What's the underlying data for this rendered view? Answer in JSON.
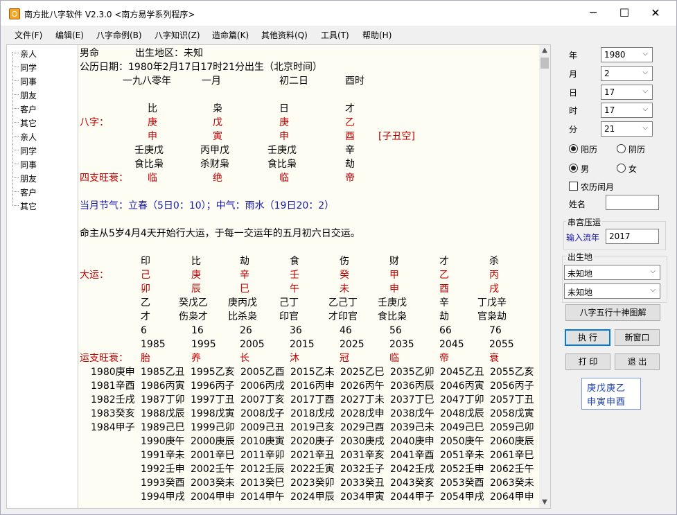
{
  "window": {
    "title": "南方批八字软件 V2.3.0   <南方易学系列程序>",
    "minimize": "─",
    "maximize": "☐",
    "close": "✕"
  },
  "menu": [
    "文件(F)",
    "编辑(E)",
    "八字命例(B)",
    "八字知识(Z)",
    "造命篇(K)",
    "其他资料(Q)",
    "工具(T)",
    "帮助(H)"
  ],
  "tree": [
    "亲人",
    "同学",
    "同事",
    "朋友",
    "客户",
    "其它",
    "亲人",
    "同学",
    "同事",
    "朋友",
    "客户",
    "其它"
  ],
  "chart": {
    "l1a": "男命",
    "l1b": "出生地区：未知",
    "l2": "公历日期：1980年2月17日17时21分出生（北京时间）",
    "lunar": [
      "一九八零年",
      "一月",
      "初二日",
      "酉时"
    ],
    "shishen": [
      "比",
      "枭",
      "日",
      "才"
    ],
    "bazi_label": "八字：",
    "gan": [
      "庚",
      "戊",
      "庚",
      "乙"
    ],
    "zhi": [
      "申",
      "寅",
      "申",
      "酉"
    ],
    "kong": "[子丑空]",
    "canggan": [
      "壬庚戊",
      "丙甲戊",
      "壬庚戊",
      "辛"
    ],
    "cangshen": [
      "食比枭",
      "杀财枭",
      "食比枭",
      "劫"
    ],
    "wangshuai_label": "四支旺衰：",
    "wangshuai": [
      "临",
      "绝",
      "临",
      "帝"
    ],
    "jieqi": "当月节气：立春（5日0：10）；中气：雨水（19日20：2）",
    "qiyun": "命主从5岁4月4天开始行大运，于每一交运年的五月初六日交运。",
    "dayun_label": "大运：",
    "dy_shishen": [
      "印",
      "比",
      "劫",
      "食",
      "伤",
      "财",
      "才",
      "杀"
    ],
    "dy_gan": [
      "己",
      "庚",
      "辛",
      "壬",
      "癸",
      "甲",
      "乙",
      "丙"
    ],
    "dy_zhi": [
      "卯",
      "辰",
      "巳",
      "午",
      "未",
      "申",
      "酉",
      "戌"
    ],
    "dy_canggan": [
      "乙",
      "癸戊乙",
      "庚丙戊",
      "己丁",
      "乙己丁",
      "壬庚戊",
      "辛",
      "丁戊辛"
    ],
    "dy_cangshen": [
      "才",
      "伤枭才",
      "比杀枭",
      "印官",
      "才印官",
      "食比枭",
      "劫",
      "官枭劫"
    ],
    "dy_age": [
      "6",
      "16",
      "26",
      "36",
      "46",
      "56",
      "66",
      "76"
    ],
    "dy_year": [
      "1985",
      "1995",
      "2005",
      "2015",
      "2025",
      "2035",
      "2045",
      "2055"
    ],
    "yzws_label": "运支旺衰：",
    "yzws": [
      "胎",
      "养",
      "长",
      "沐",
      "冠",
      "临",
      "帝",
      "衰"
    ],
    "xiaoyun": [
      "1980庚申",
      "1981辛酉",
      "1982壬戌",
      "1983癸亥",
      "1984甲子"
    ],
    "liunian": [
      [
        "1985乙丑",
        "1995乙亥",
        "2005乙酉",
        "2015乙未",
        "2025乙巳",
        "2035乙卯",
        "2045乙丑",
        "2055乙亥"
      ],
      [
        "1986丙寅",
        "1996丙子",
        "2006丙戌",
        "2016丙申",
        "2026丙午",
        "2036丙辰",
        "2046丙寅",
        "2056丙子"
      ],
      [
        "1987丁卯",
        "1997丁丑",
        "2007丁亥",
        "2017丁酉",
        "2027丁未",
        "2037丁巳",
        "2047丁卯",
        "2057丁丑"
      ],
      [
        "1988戊辰",
        "1998戊寅",
        "2008戊子",
        "2018戊戌",
        "2028戊申",
        "2038戊午",
        "2048戊辰",
        "2058戊寅"
      ],
      [
        "1989己巳",
        "1999己卯",
        "2009己丑",
        "2019己亥",
        "2029己酉",
        "2039己未",
        "2049己巳",
        "2059己卯"
      ],
      [
        "1990庚午",
        "2000庚辰",
        "2010庚寅",
        "2020庚子",
        "2030庚戌",
        "2040庚申",
        "2050庚午",
        "2060庚辰"
      ],
      [
        "1991辛未",
        "2001辛巳",
        "2011辛卯",
        "2021辛丑",
        "2031辛亥",
        "2041辛酉",
        "2051辛未",
        "2061辛巳"
      ],
      [
        "1992壬申",
        "2002壬午",
        "2012壬辰",
        "2022壬寅",
        "2032壬子",
        "2042壬戌",
        "2052壬申",
        "2062壬午"
      ],
      [
        "1993癸酉",
        "2003癸未",
        "2013癸巳",
        "2023癸卯",
        "2033癸丑",
        "2043癸亥",
        "2053癸酉",
        "2063癸未"
      ],
      [
        "1994甲戌",
        "2004甲申",
        "2014甲午",
        "2024甲辰",
        "2034甲寅",
        "2044甲子",
        "2054甲戌",
        "2064甲申"
      ]
    ]
  },
  "panel": {
    "year_label": "年",
    "year": "1980",
    "month_label": "月",
    "month": "2",
    "day_label": "日",
    "day": "17",
    "hour_label": "时",
    "hour": "17",
    "minute_label": "分",
    "minute": "21",
    "solar": "阳历",
    "lunar": "阴历",
    "male": "男",
    "female": "女",
    "leap": "农历闰月",
    "name_label": "姓名",
    "name": "",
    "chuangong_title": "串宫压运",
    "liunian_link": "输入流年",
    "liunian_value": "2017",
    "birthplace_title": "出生地",
    "place1": "未知地",
    "place2": "未知地",
    "wuxing_btn": "八字五行十神图解",
    "run_btn": "执 行",
    "newwin_btn": "新窗口",
    "print_btn": "打 印",
    "exit_btn": "退 出",
    "badge_l1": "庚戊庚乙",
    "badge_l2": "申寅申酉"
  }
}
